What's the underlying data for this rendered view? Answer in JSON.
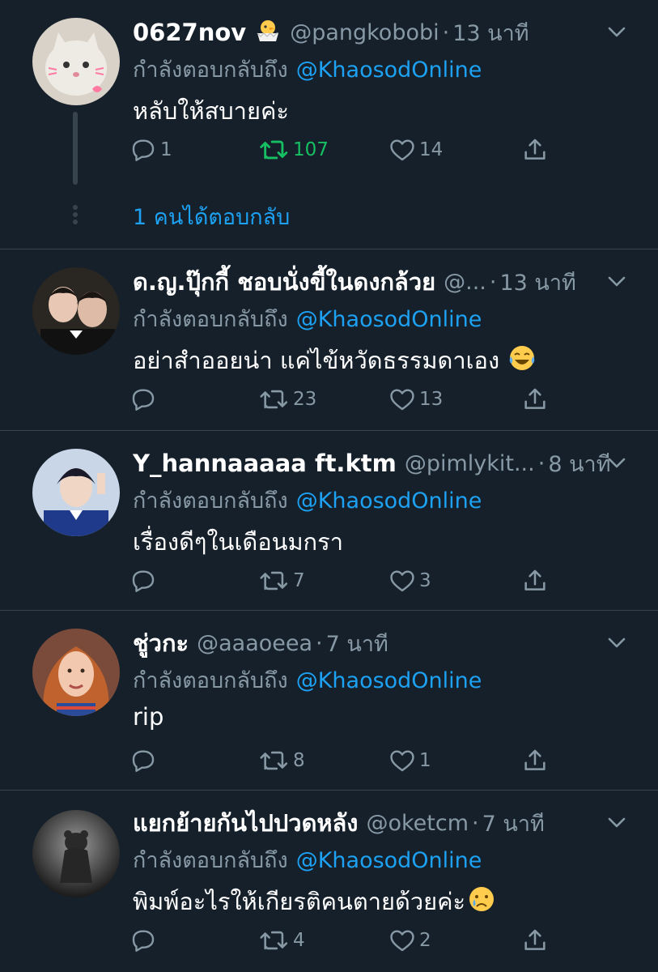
{
  "colors": {
    "background": "#15202b",
    "secondary_text": "#8899a6",
    "link": "#1da1f2",
    "retweet_active": "#17bf63",
    "divider": "#38444d"
  },
  "replying_label": "กำลังตอบกลับถึง",
  "tweets": [
    {
      "name": "0627nov",
      "handle": "@pangkobobi",
      "time": "13 นาที",
      "name_emoji": "hatching-chick-icon",
      "mention": "@KhaosodOnline",
      "text": "หลับให้สบายค่ะ",
      "replies": "1",
      "retweets": "107",
      "likes": "14",
      "retweeted": true,
      "show_replies": "1 คนได้ตอบกลับ"
    },
    {
      "name": "ด.ญ.ปุ๊กกี้ ชอบนั่งขี้ในดงกล้วย",
      "handle": "@...",
      "time": "13 นาที",
      "mention": "@KhaosodOnline",
      "text": "อย่าสำออยน่า แค่ไข้หวัดธรรมดาเอง",
      "text_emoji": "tears-of-joy-icon",
      "replies": "",
      "retweets": "23",
      "likes": "13"
    },
    {
      "name": "Y_hannaaaaa ft.ktm",
      "handle": "@pimlykit...",
      "time": "8 นาที",
      "mention": "@KhaosodOnline",
      "text": "เรื่องดีๆในเดือนมกรา",
      "replies": "",
      "retweets": "7",
      "likes": "3"
    },
    {
      "name": "ชู่วกะ",
      "handle": "@aaaoeea",
      "time": "7 นาที",
      "mention": "@KhaosodOnline",
      "text": "rip",
      "replies": "",
      "retweets": "8",
      "likes": "1"
    },
    {
      "name": "แยกย้ายกันไปปวดหลัง",
      "handle": "@oketcm",
      "time": "7 นาที",
      "mention": "@KhaosodOnline",
      "text": "พิมพ์อะไรให้เกียรติคนตายด้วยค่ะ",
      "text_emoji": "crying-face-icon",
      "replies": "",
      "retweets": "4",
      "likes": "2"
    }
  ]
}
